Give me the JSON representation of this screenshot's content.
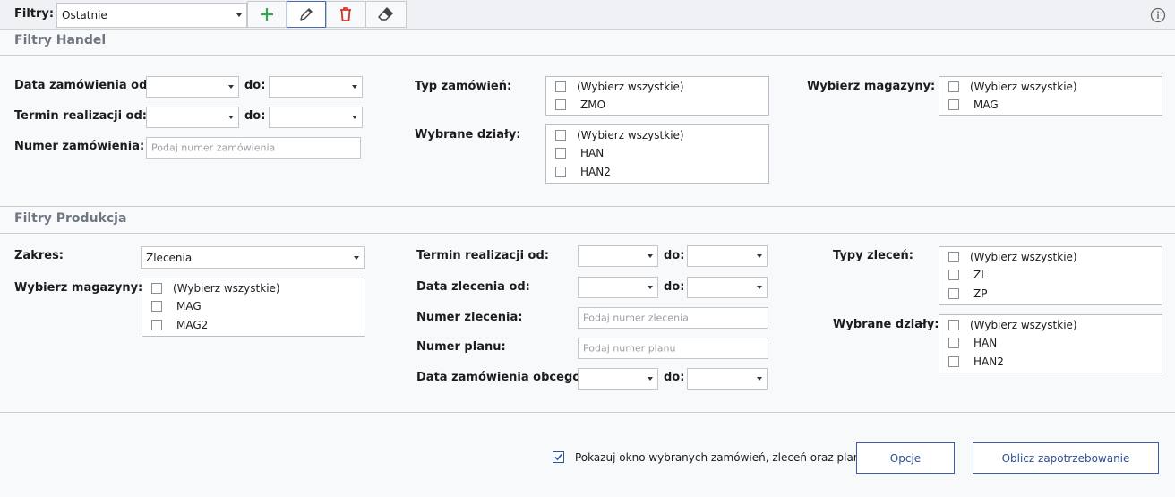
{
  "toolbar": {
    "label": "Filtry:",
    "selected_filter": "Ostatnie",
    "icons": {
      "add": "plus-icon",
      "edit": "pencil-icon",
      "delete": "trash-icon",
      "clear": "eraser-icon",
      "info": "info-icon"
    },
    "colors": {
      "add": "#2fa84f",
      "delete": "#d93025"
    }
  },
  "handel": {
    "title": "Filtry Handel",
    "order_date_from_label": "Data zamówienia od:",
    "order_date_to_label": "do:",
    "due_date_from_label": "Termin realizacji od:",
    "due_date_to_label": "do:",
    "order_number_label": "Numer zamówienia:",
    "order_number_placeholder": "Podaj numer zamówienia",
    "order_type_label": "Typ zamówień:",
    "order_types": [
      "(Wybierz wszystkie)",
      "ZMO"
    ],
    "departments_label": "Wybrane działy:",
    "departments": [
      "(Wybierz wszystkie)",
      "HAN",
      "HAN2"
    ],
    "warehouses_label": "Wybierz magazyny:",
    "warehouses": [
      "(Wybierz wszystkie)",
      "MAG"
    ]
  },
  "produkcja": {
    "title": "Filtry Produkcja",
    "range_label": "Zakres:",
    "range_value": "Zlecenia",
    "warehouses_label": "Wybierz magazyny:",
    "warehouses": [
      "(Wybierz wszystkie)",
      "MAG",
      "MAG2"
    ],
    "due_date_from_label": "Termin realizacji od:",
    "due_date_to_label": "do:",
    "order_date_from_label": "Data zlecenia od:",
    "order_date_to_label": "do:",
    "order_number_label": "Numer zlecenia:",
    "order_number_placeholder": "Podaj numer zlecenia",
    "plan_number_label": "Numer planu:",
    "plan_number_placeholder": "Podaj numer planu",
    "external_date_label": "Data zamówienia obcego:",
    "external_date_to_label": "do:",
    "order_types_label": "Typy zleceń:",
    "order_types": [
      "(Wybierz wszystkie)",
      "ZL",
      "ZP"
    ],
    "departments_label": "Wybrane działy:",
    "departments": [
      "(Wybierz wszystkie)",
      "HAN",
      "HAN2"
    ]
  },
  "footer": {
    "show_window_label": "Pokazuj okno wybranych zamówień, zleceń oraz planów",
    "show_window_checked": true,
    "options_button": "Opcje",
    "calculate_button": "Oblicz zapotrzebowanie"
  }
}
